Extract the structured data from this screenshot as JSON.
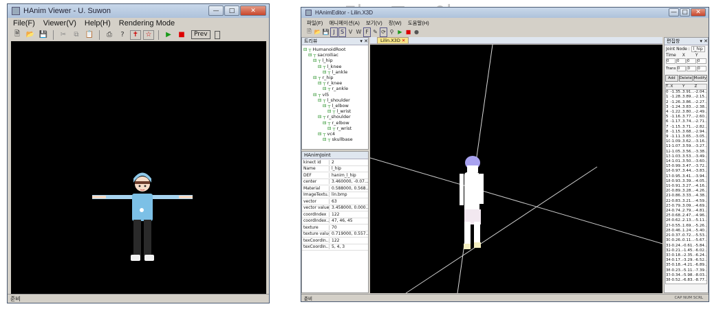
{
  "window1": {
    "title": "HAnim Viewer - U. Suwon",
    "menu": [
      "File(F)",
      "Viewer(V)",
      "Help(H)",
      "Rendering Mode"
    ],
    "toolbar_prev": "Prev",
    "status": "준비"
  },
  "window2": {
    "title": "HAnimEditor - Lilin.X3D",
    "menu": [
      "파일(F)",
      "애니메이션(A)",
      "보기(V)",
      "창(W)",
      "도움말(H)"
    ],
    "doc_tab": "Lilin.X3D",
    "tree_title": "트리뷰",
    "tree": [
      {
        "label": "HumanoidRoot",
        "indent": 0
      },
      {
        "label": "sacroiliac",
        "indent": 1
      },
      {
        "label": "l_hip",
        "indent": 2
      },
      {
        "label": "l_knee",
        "indent": 3
      },
      {
        "label": "l_ankle",
        "indent": 4
      },
      {
        "label": "r_hip",
        "indent": 2
      },
      {
        "label": "r_knee",
        "indent": 3
      },
      {
        "label": "r_ankle",
        "indent": 4
      },
      {
        "label": "vl5",
        "indent": 2
      },
      {
        "label": "l_shoulder",
        "indent": 3
      },
      {
        "label": "l_elbow",
        "indent": 4
      },
      {
        "label": "l_wrist",
        "indent": 5
      },
      {
        "label": "r_shoulder",
        "indent": 3
      },
      {
        "label": "r_elbow",
        "indent": 4
      },
      {
        "label": "r_wrist",
        "indent": 5
      },
      {
        "label": "vc4",
        "indent": 3
      },
      {
        "label": "skullbase",
        "indent": 4
      }
    ],
    "props_title": "HAnimJoint",
    "props": [
      [
        "kinect id",
        "2"
      ],
      [
        "Name",
        "l_hip"
      ],
      [
        "DEF",
        "hanim_l_hip"
      ],
      [
        "center",
        "3.460000, -0.07..."
      ],
      [
        "Material",
        "0.588000, 0.568..."
      ],
      [
        "ImageTextu...",
        "lin.bmp"
      ],
      [
        "vector",
        "63"
      ],
      [
        "vector value",
        "3.458000, 0.000..."
      ],
      [
        "coordIndex",
        "122"
      ],
      [
        "coordIndex...",
        "47, 46, 45"
      ],
      [
        "texture",
        "70"
      ],
      [
        "texture value",
        "0.719000, 0.557..."
      ],
      [
        "texCoordIn...",
        "122"
      ],
      [
        "texCoordIn...",
        "5, 4, 3"
      ]
    ],
    "right_title": "편집창",
    "joint_node_label": "Joint Node :",
    "joint_node_value": "l_hip",
    "time_label": "Time",
    "x_label": "X",
    "y_label": "Y",
    "z_label": "Z",
    "time_values": [
      "0",
      "0",
      "0",
      "0"
    ],
    "translate_label": "Translate",
    "translate_values": [
      "0",
      "0",
      "0"
    ],
    "add": "Add",
    "delete": "Delete",
    "modify": "Modify",
    "table_headers": [
      "T...",
      "X",
      "Y",
      "Z"
    ],
    "table_rows": [
      [
        "0",
        "-1.35...",
        "3.91...",
        "-2.04..."
      ],
      [
        "1",
        "-1.28...",
        "3.89...",
        "-2.15..."
      ],
      [
        "2",
        "-1.26...",
        "3.86...",
        "-2.27..."
      ],
      [
        "3",
        "-1.24...",
        "3.83...",
        "-2.38..."
      ],
      [
        "4",
        "-1.22...",
        "3.80...",
        "-2.49..."
      ],
      [
        "5",
        "-1.16...",
        "3.77...",
        "-2.60..."
      ],
      [
        "6",
        "-1.17...",
        "3.74...",
        "-2.71..."
      ],
      [
        "7",
        "-1.15...",
        "3.71...",
        "-2.82..."
      ],
      [
        "8",
        "-1.15...",
        "3.68...",
        "-2.94..."
      ],
      [
        "9",
        "-1.11...",
        "3.65...",
        "-3.05..."
      ],
      [
        "10",
        "-1.09...",
        "3.62...",
        "-3.16..."
      ],
      [
        "11",
        "-1.07...",
        "3.59...",
        "-3.27..."
      ],
      [
        "12",
        "-1.05...",
        "3.56...",
        "-3.38..."
      ],
      [
        "13",
        "-1.03...",
        "3.53...",
        "-3.49..."
      ],
      [
        "14",
        "-1.01...",
        "3.50...",
        "-3.60..."
      ],
      [
        "15",
        "-0.99...",
        "3.47...",
        "-3.72..."
      ],
      [
        "16",
        "-0.97...",
        "3.44...",
        "-3.83..."
      ],
      [
        "17",
        "-0.95...",
        "3.41...",
        "-3.94..."
      ],
      [
        "18",
        "-0.93...",
        "3.39...",
        "-4.05..."
      ],
      [
        "19",
        "-0.91...",
        "3.27...",
        "-4.16..."
      ],
      [
        "20",
        "-0.89...",
        "3.28...",
        "-4.26..."
      ],
      [
        "21",
        "-0.86...",
        "3.33...",
        "-4.38..."
      ],
      [
        "22",
        "-0.83...",
        "3.21...",
        "-4.59..."
      ],
      [
        "23",
        "-0.79...",
        "3.09...",
        "-4.69..."
      ],
      [
        "24",
        "-0.74...",
        "2.79...",
        "-4.81..."
      ],
      [
        "25",
        "-0.68...",
        "2.47...",
        "-4.96..."
      ],
      [
        "26",
        "-0.62...",
        "2.13...",
        "-5.11..."
      ],
      [
        "27",
        "-0.55...",
        "1.69...",
        "-5.26..."
      ],
      [
        "28",
        "-0.46...",
        "1.24...",
        "-5.40..."
      ],
      [
        "29",
        "-0.37...",
        "0.72...",
        "-5.53..."
      ],
      [
        "30",
        "-0.26...",
        "0.11...",
        "-5.67..."
      ],
      [
        "31",
        "-0.24...",
        "-0.61...",
        "-5.84..."
      ],
      [
        "32",
        "-0.21...",
        "-1.45...",
        "-6.02..."
      ],
      [
        "33",
        "-0.18...",
        "-2.35...",
        "-6.24..."
      ],
      [
        "34",
        "-0.17...",
        "-3.29...",
        "-6.52..."
      ],
      [
        "35",
        "-0.18...",
        "-4.21...",
        "-6.89..."
      ],
      [
        "36",
        "-0.23...",
        "-5.11...",
        "-7.39..."
      ],
      [
        "37",
        "-0.34...",
        "-5.98...",
        "-8.03..."
      ],
      [
        "38",
        "-0.52...",
        "-6.83...",
        "-8.77..."
      ]
    ],
    "status": "준비",
    "status_right": "CAP NUM SCRL"
  },
  "background_text": "리 그 이 ㄱ ㄴ"
}
